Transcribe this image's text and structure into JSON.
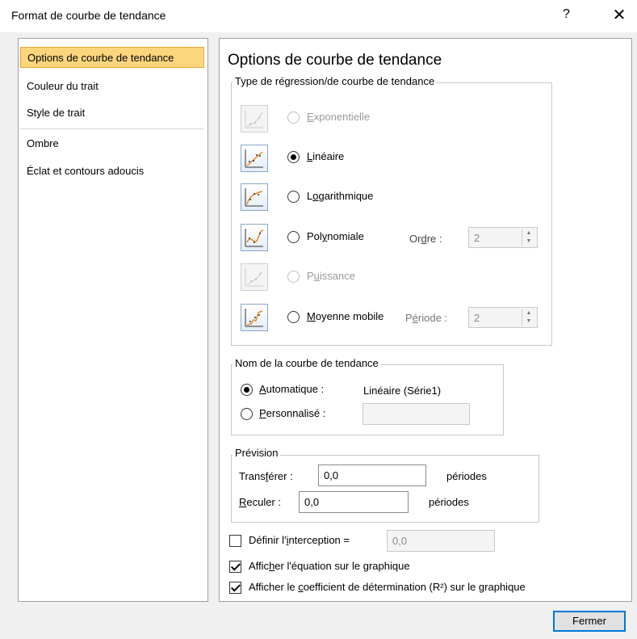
{
  "window": {
    "title": "Format de courbe de tendance",
    "help": "?",
    "close": "✕"
  },
  "nav": {
    "items": [
      {
        "label": "Options de courbe de tendance",
        "selected": true
      },
      {
        "label": "Couleur du trait"
      },
      {
        "label": "Style de trait"
      },
      {
        "label": "Ombre"
      },
      {
        "label": "Éclat et contours adoucis"
      }
    ]
  },
  "page_title": "Options de courbe de tendance",
  "regression": {
    "group_label": "Type de régression/de courbe de tendance",
    "options": [
      {
        "pre": "",
        "ul": "E",
        "post": "xponentielle",
        "enabled": false,
        "checked": false,
        "icon": "exponential-trend-icon"
      },
      {
        "pre": "",
        "ul": "L",
        "post": "inéaire",
        "enabled": true,
        "checked": true,
        "icon": "linear-trend-icon"
      },
      {
        "pre": "L",
        "ul": "o",
        "post": "garithmique",
        "enabled": true,
        "checked": false,
        "icon": "logarithmic-trend-icon"
      },
      {
        "pre": "Pol",
        "ul": "y",
        "post": "nomiale",
        "enabled": true,
        "checked": false,
        "icon": "polynomial-trend-icon"
      },
      {
        "pre": "P",
        "ul": "u",
        "post": "issance",
        "enabled": false,
        "checked": false,
        "icon": "power-trend-icon"
      },
      {
        "pre": "",
        "ul": "M",
        "post": "oyenne mobile",
        "enabled": true,
        "checked": false,
        "icon": "moving-average-trend-icon"
      }
    ],
    "order": {
      "pre": "Or",
      "ul": "d",
      "post": "re :",
      "value": "2"
    },
    "period": {
      "pre": "P",
      "ul": "é",
      "post": "riode :",
      "value": "2"
    }
  },
  "trendline_name": {
    "group_label": "Nom de la courbe de tendance",
    "auto": {
      "ul": "A",
      "post": "utomatique :",
      "value": "Linéaire (Série1)",
      "checked": true
    },
    "custom": {
      "ul": "P",
      "post": "ersonnalisé :",
      "value": "",
      "checked": false
    }
  },
  "forecast": {
    "group_label": "Prévision",
    "forward": {
      "pre": "Trans",
      "ul": "f",
      "post": "érer :",
      "value": "0,0",
      "unit": "périodes"
    },
    "backward": {
      "pre": "",
      "ul": "R",
      "post": "eculer :",
      "value": "0,0",
      "unit": "périodes"
    }
  },
  "options": {
    "intercept": {
      "pre": "Définir l'",
      "ul": "i",
      "post": "nterception =",
      "value": "0,0",
      "checked": false
    },
    "show_equation": {
      "pre": "Affic",
      "ul": "h",
      "post": "er l'équation sur le graphique",
      "checked": true
    },
    "show_r2": {
      "pre": "Afficher le ",
      "ul": "c",
      "post": "oefficient de détermination (R²) sur le graphique",
      "checked": true
    }
  },
  "close_button": "Fermer"
}
